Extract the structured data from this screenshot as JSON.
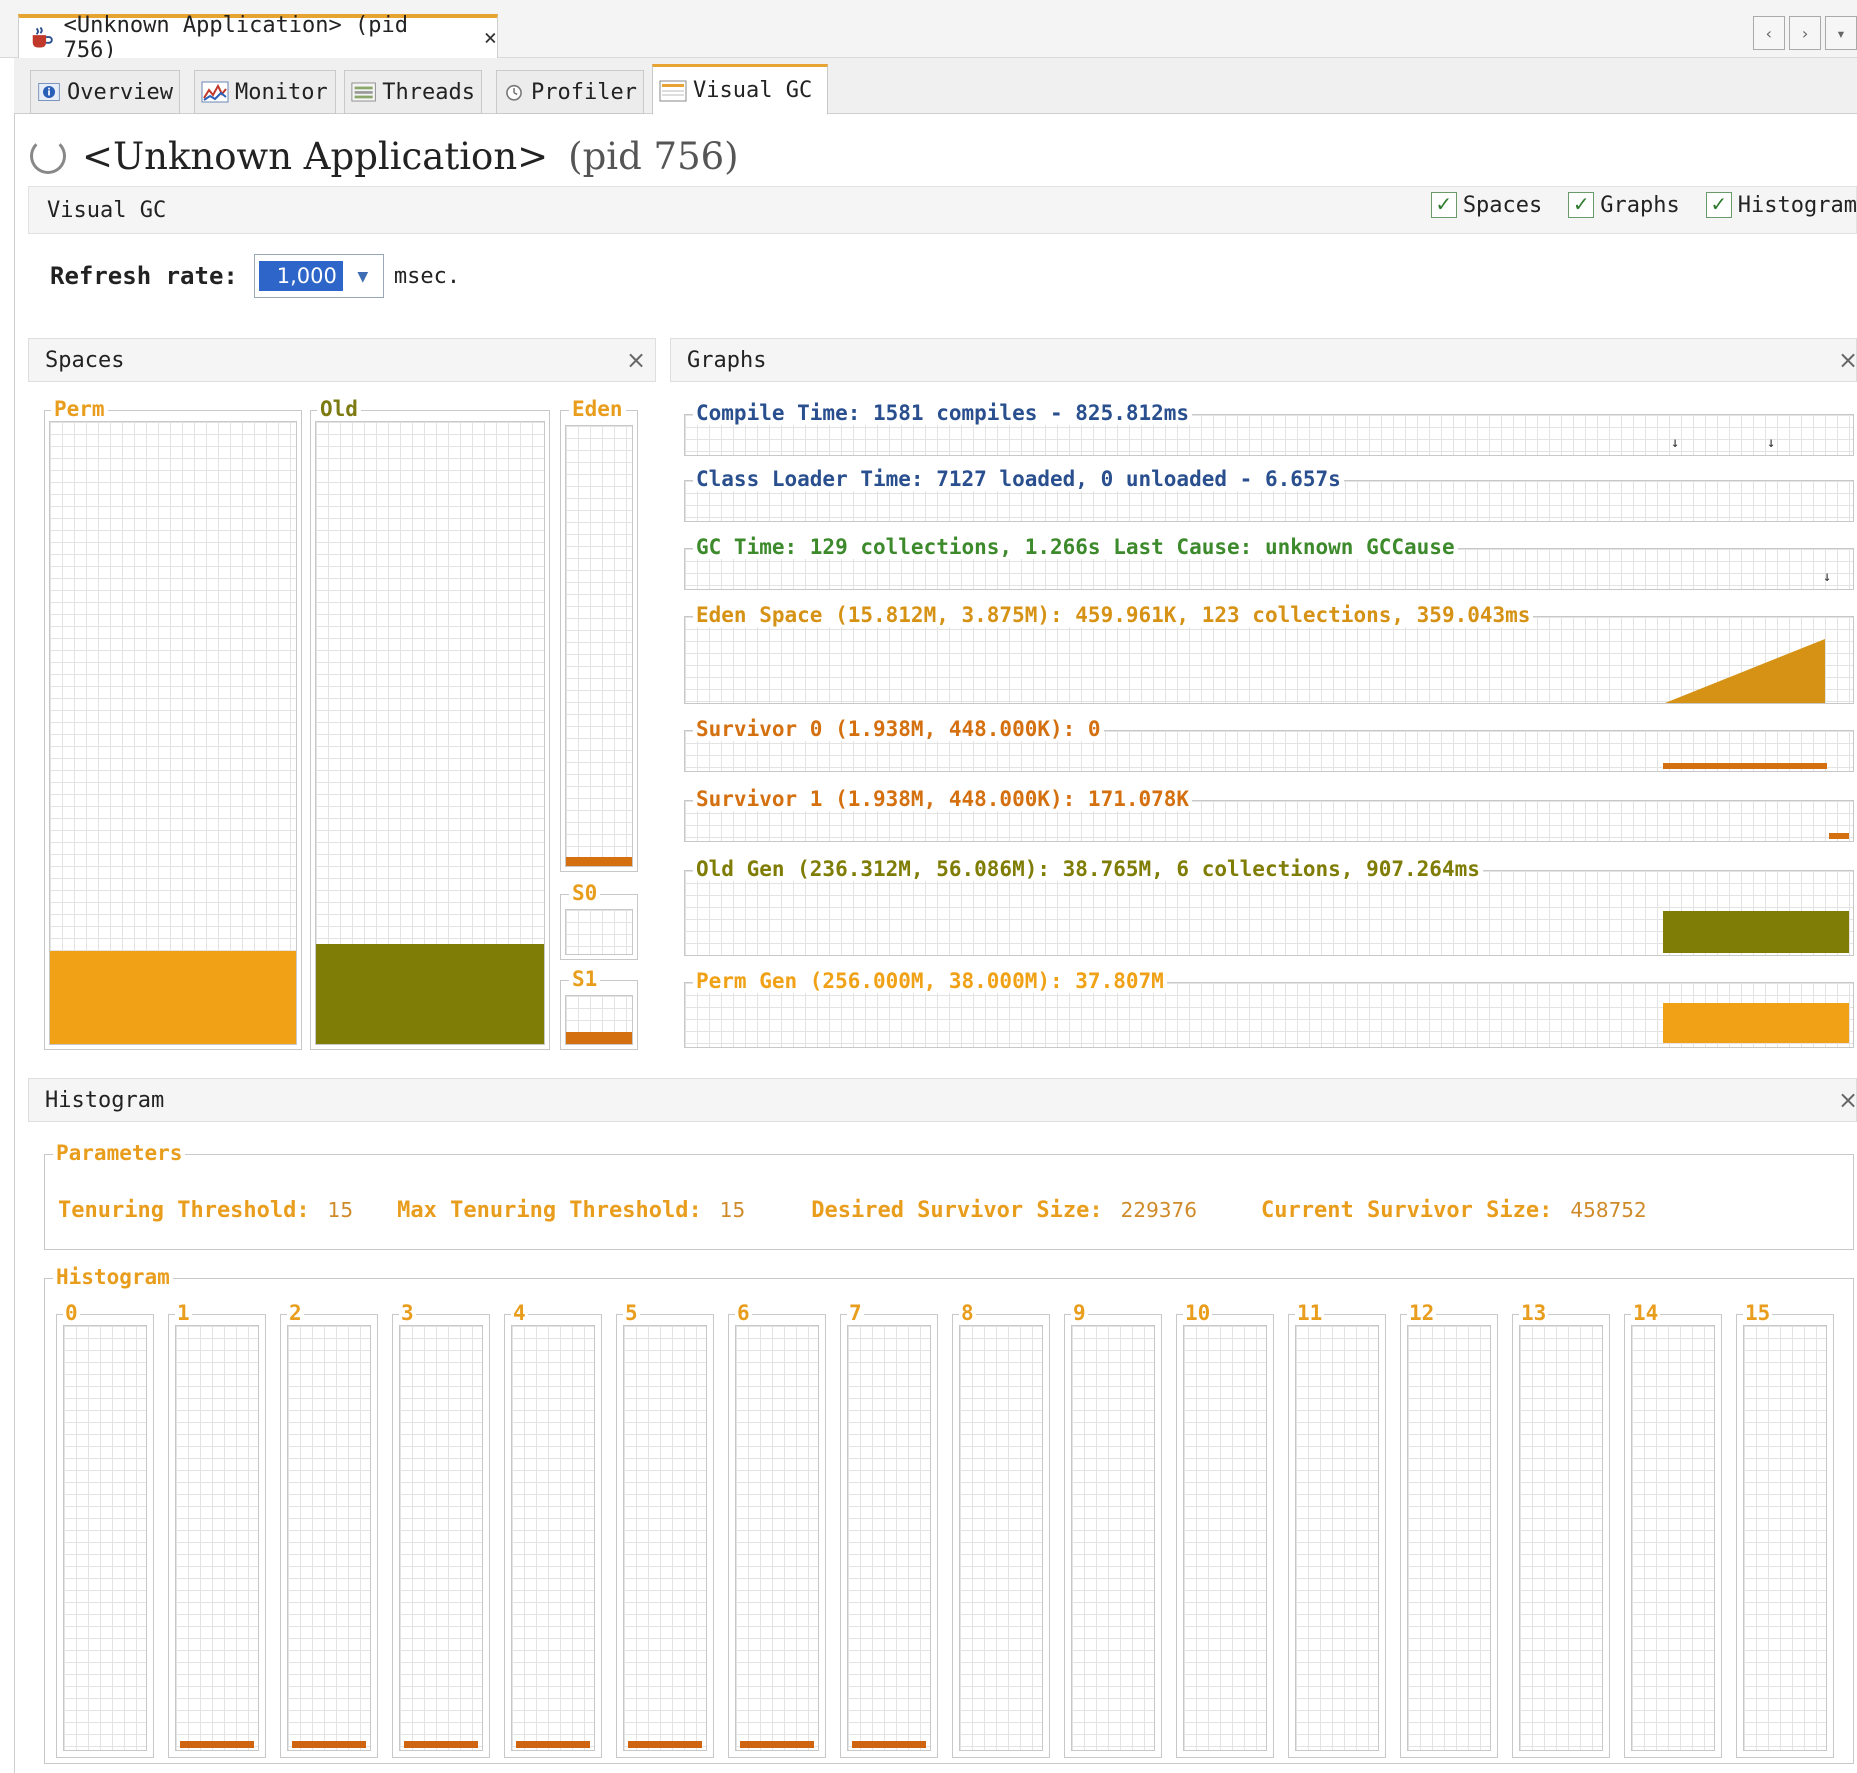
{
  "document_tab": {
    "title": "<Unknown Application> (pid 756)",
    "close": "×"
  },
  "nav": {
    "prev": "‹",
    "next": "›",
    "menu": "▾"
  },
  "sub_tabs": [
    {
      "label": "Overview"
    },
    {
      "label": "Monitor"
    },
    {
      "label": "Threads"
    },
    {
      "label": "Profiler"
    },
    {
      "label": "Visual GC"
    }
  ],
  "app": {
    "name": "<Unknown Application>",
    "pid": "(pid 756)"
  },
  "visual_gc": {
    "title": "Visual GC",
    "checkboxes": [
      {
        "label": "Spaces",
        "checked": true
      },
      {
        "label": "Graphs",
        "checked": true
      },
      {
        "label": "Histogram",
        "checked": true
      }
    ],
    "refresh_label": "Refresh rate:",
    "refresh_value": "1,000",
    "refresh_unit": "msec."
  },
  "spaces": {
    "title": "Spaces",
    "close": "×",
    "perm": {
      "label": "Perm",
      "fill": 0.15,
      "color": "#f0a115"
    },
    "old": {
      "label": "Old",
      "fill": 0.16,
      "color": "#7f7d05"
    },
    "eden": {
      "label": "Eden",
      "fill": 0.02,
      "color": "#d4700f"
    },
    "s0": {
      "label": "S0",
      "fill": 0.0
    },
    "s1": {
      "label": "S1",
      "fill": 0.25,
      "color": "#d4700f"
    }
  },
  "graphs": {
    "title": "Graphs",
    "close": "×",
    "rows": [
      {
        "text": "Compile Time: 1581 compiles - 825.812ms",
        "color": "#2a4f8e"
      },
      {
        "text": "Class Loader Time: 7127 loaded, 0 unloaded - 6.657s",
        "color": "#2a4f8e"
      },
      {
        "text": "GC Time: 129 collections, 1.266s  Last Cause: unknown GCCause",
        "color": "#3d8a2c"
      },
      {
        "text": "Eden Space (15.812M, 3.875M): 459.961K, 123 collections, 359.043ms",
        "color": "#d69215"
      },
      {
        "text": "Survivor 0 (1.938M, 448.000K): 0",
        "color": "#d4700f"
      },
      {
        "text": "Survivor 1 (1.938M, 448.000K): 171.078K",
        "color": "#d4700f"
      },
      {
        "text": "Old Gen (236.312M, 56.086M): 38.765M, 6 collections, 907.264ms",
        "color": "#7f7d05"
      },
      {
        "text": "Perm Gen (256.000M, 38.000M): 37.807M",
        "color": "#f0a115"
      }
    ]
  },
  "histogram": {
    "title": "Histogram",
    "close": "×",
    "parameters": {
      "title": "Parameters",
      "tenuring_threshold_label": "Tenuring Threshold:",
      "tenuring_threshold": "15",
      "max_tenuring_threshold_label": "Max Tenuring Threshold:",
      "max_tenuring_threshold": "15",
      "desired_survivor_size_label": "Desired Survivor Size:",
      "desired_survivor_size": "229376",
      "current_survivor_size_label": "Current Survivor Size:",
      "current_survivor_size": "458752"
    },
    "histogram_title": "Histogram",
    "buckets": [
      {
        "label": "0",
        "filled": false
      },
      {
        "label": "1",
        "filled": true
      },
      {
        "label": "2",
        "filled": true
      },
      {
        "label": "3",
        "filled": true
      },
      {
        "label": "4",
        "filled": true
      },
      {
        "label": "5",
        "filled": true
      },
      {
        "label": "6",
        "filled": true
      },
      {
        "label": "7",
        "filled": true
      },
      {
        "label": "8",
        "filled": false
      },
      {
        "label": "9",
        "filled": false
      },
      {
        "label": "10",
        "filled": false
      },
      {
        "label": "11",
        "filled": false
      },
      {
        "label": "12",
        "filled": false
      },
      {
        "label": "13",
        "filled": false
      },
      {
        "label": "14",
        "filled": false
      },
      {
        "label": "15",
        "filled": false
      }
    ]
  }
}
